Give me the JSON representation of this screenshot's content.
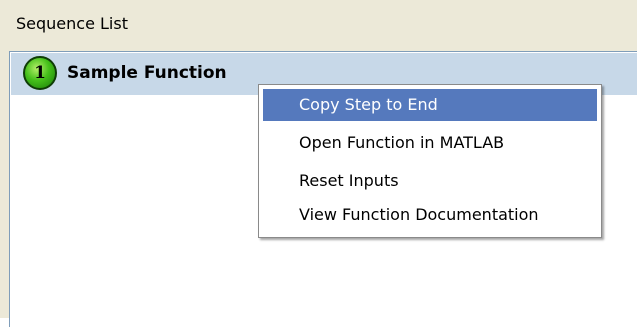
{
  "panel": {
    "title": "Sequence List"
  },
  "sequence": {
    "step_number": "1",
    "step_name": "Sample Function"
  },
  "context_menu": {
    "items": [
      {
        "label": "Copy Step to End",
        "highlighted": true
      },
      {
        "label": "Open Function in MATLAB",
        "highlighted": false
      },
      {
        "label": "Reset Inputs",
        "highlighted": false
      },
      {
        "label": "View Function Documentation",
        "highlighted": false
      }
    ]
  },
  "colors": {
    "panel_bg": "#ece9d8",
    "row_selected": "#c7d8e8",
    "menu_highlight": "#5579bd",
    "badge_green": "#45c01a"
  }
}
